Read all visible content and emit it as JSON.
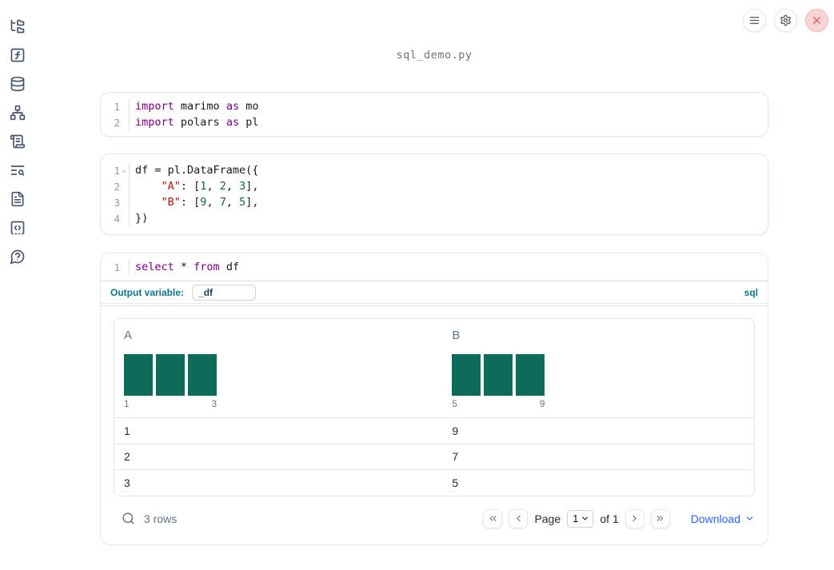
{
  "title": "sql_demo.py",
  "topbar": {
    "buttons": [
      {
        "name": "notebook-menu",
        "icon": "hamburger-menu-icon"
      },
      {
        "name": "settings",
        "icon": "gear-icon"
      },
      {
        "name": "shutdown",
        "icon": "close-x-icon",
        "accent": "#dd5a5a"
      }
    ]
  },
  "sidebar": {
    "items": [
      {
        "name": "file-explorer",
        "icon": "folder-tree-icon"
      },
      {
        "name": "variables",
        "icon": "function-square-icon"
      },
      {
        "name": "datasources",
        "icon": "database-icon"
      },
      {
        "name": "dependencies",
        "icon": "network-icon"
      },
      {
        "name": "scratchpad",
        "icon": "scroll-text-icon"
      },
      {
        "name": "logs",
        "icon": "text-search-icon"
      },
      {
        "name": "documentation",
        "icon": "file-text-icon"
      },
      {
        "name": "snippets",
        "icon": "code-snippet-icon"
      },
      {
        "name": "help",
        "icon": "help-bubble-icon"
      }
    ]
  },
  "cells": [
    {
      "kind": "python",
      "lines": [
        {
          "n": "1",
          "tokens": [
            [
              "kw",
              "import"
            ],
            [
              "pl",
              " marimo "
            ],
            [
              "kw",
              "as"
            ],
            [
              "pl",
              " mo"
            ]
          ]
        },
        {
          "n": "2",
          "tokens": [
            [
              "kw",
              "import"
            ],
            [
              "pl",
              " polars "
            ],
            [
              "kw",
              "as"
            ],
            [
              "pl",
              " pl"
            ]
          ]
        }
      ]
    },
    {
      "kind": "python",
      "lines": [
        {
          "n": "1",
          "fold": true,
          "tokens": [
            [
              "pl",
              "df = pl.DataFrame({"
            ]
          ]
        },
        {
          "n": "2",
          "tokens": [
            [
              "pl",
              "    "
            ],
            [
              "str",
              "\"A\""
            ],
            [
              "pl",
              ": ["
            ],
            [
              "num",
              "1"
            ],
            [
              "pl",
              ", "
            ],
            [
              "num",
              "2"
            ],
            [
              "pl",
              ", "
            ],
            [
              "num",
              "3"
            ],
            [
              "pl",
              "],"
            ]
          ]
        },
        {
          "n": "3",
          "tokens": [
            [
              "pl",
              "    "
            ],
            [
              "str",
              "\"B\""
            ],
            [
              "pl",
              ": ["
            ],
            [
              "num",
              "9"
            ],
            [
              "pl",
              ", "
            ],
            [
              "num",
              "7"
            ],
            [
              "pl",
              ", "
            ],
            [
              "num",
              "5"
            ],
            [
              "pl",
              "],"
            ]
          ]
        },
        {
          "n": "4",
          "tokens": [
            [
              "pl",
              "})"
            ]
          ]
        }
      ]
    },
    {
      "kind": "sql",
      "lines": [
        {
          "n": "1",
          "tokens": [
            [
              "kw",
              "select"
            ],
            [
              "pl",
              " * "
            ],
            [
              "kw",
              "from"
            ],
            [
              "pl",
              " df"
            ]
          ]
        }
      ]
    }
  ],
  "sql_cell": {
    "output_variable_label": "Output variable:",
    "output_variable_value": "_df",
    "language_label": "sql"
  },
  "table": {
    "columns": [
      {
        "name": "A",
        "histogram": {
          "bars": [
            1,
            1,
            1
          ],
          "min_label": "1",
          "max_label": "3"
        }
      },
      {
        "name": "B",
        "histogram": {
          "bars": [
            1,
            1,
            1
          ],
          "min_label": "5",
          "max_label": "9"
        }
      }
    ],
    "rows": [
      [
        "1",
        "9"
      ],
      [
        "2",
        "7"
      ],
      [
        "3",
        "5"
      ]
    ],
    "footer": {
      "row_count": "3 rows",
      "page_label": "Page",
      "page_value": "1",
      "of_label": "of 1",
      "download_label": "Download"
    }
  },
  "colors": {
    "accent_teal": "#0e7490",
    "histogram_bar": "#0e6b5a",
    "keyword": "#770088",
    "string": "#aa1111",
    "number": "#116644",
    "link_blue": "#2563eb",
    "close_red": "#dd5a5a",
    "border": "#e2e8f0"
  }
}
